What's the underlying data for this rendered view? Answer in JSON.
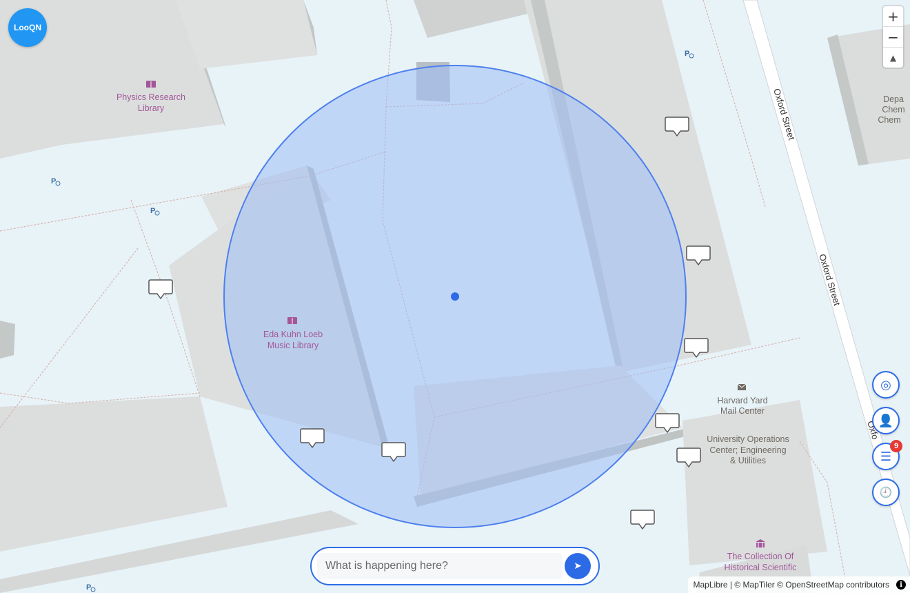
{
  "app": {
    "logo_text": "LooQN"
  },
  "map_labels": {
    "physics_library_line1": "Physics Research",
    "physics_library_line2": "Library",
    "music_library_line1": "Eda Kuhn Loeb",
    "music_library_line2": "Music Library",
    "mail_center_line1": "Harvard Yard",
    "mail_center_line2": "Mail Center",
    "ops_center_line1": "University Operations",
    "ops_center_line2": "Center; Engineering",
    "ops_center_line3": "& Utilities",
    "collection_line1": "The Collection Of",
    "collection_line2": "Historical Scientific",
    "street_oxford": "Oxford Street",
    "street_oxford_short": "Oxfo",
    "dept_line1": "Depa",
    "dept_line2": "Chem",
    "dept_line3": "Chem"
  },
  "controls": {
    "zoom_in": "+",
    "zoom_out": "−",
    "compass": "▲",
    "locate_icon": "◎",
    "profile_icon": "👤",
    "list_icon": "☰",
    "list_badge": "9",
    "history_icon": "🕘"
  },
  "composer": {
    "placeholder": "What is happening here?",
    "send_icon": "➤"
  },
  "attribution": {
    "text": "MapLibre | © MapTiler © OpenStreetMap contributors",
    "info_icon": "i"
  },
  "colors": {
    "accent": "#2d6be6",
    "logo": "#2196f3",
    "badge": "#e53935",
    "radius_fill": "#9ebef5"
  }
}
